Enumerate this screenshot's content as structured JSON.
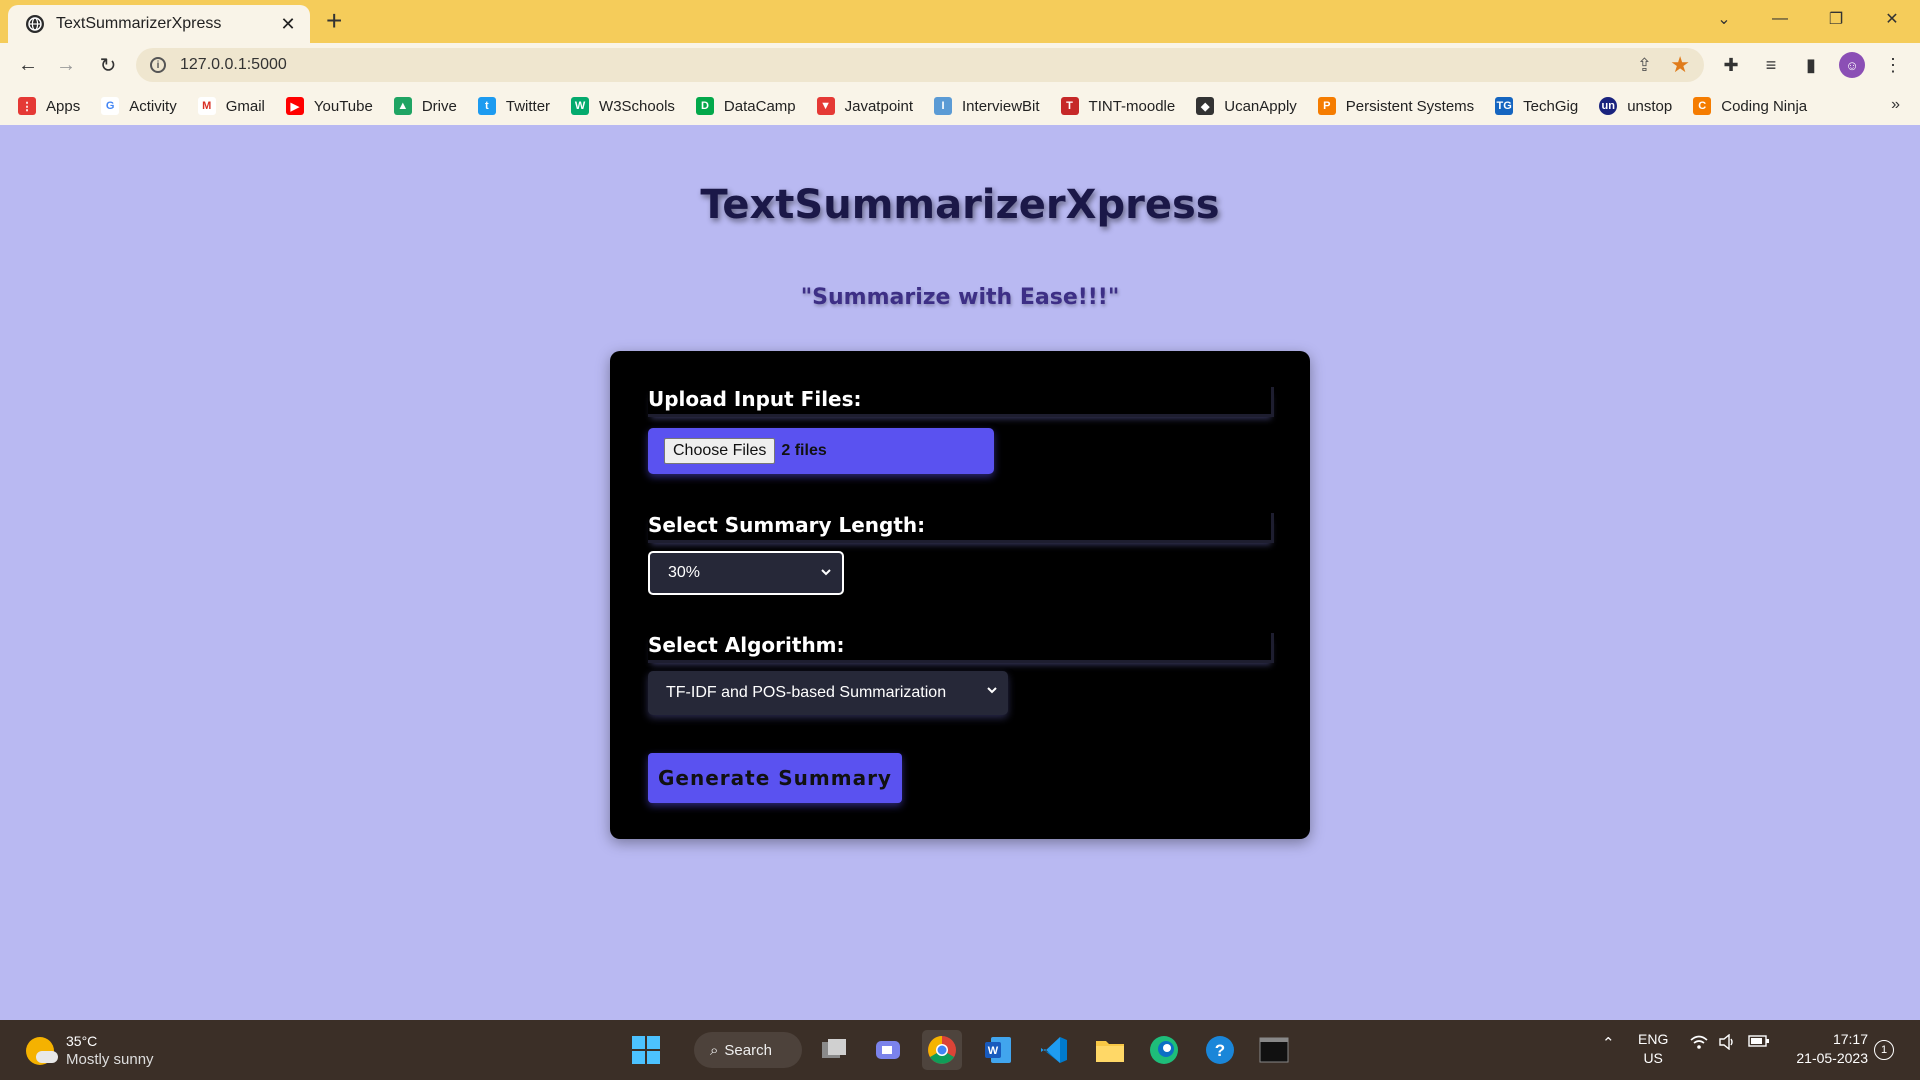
{
  "browser": {
    "tab_title": "TextSummarizerXpress",
    "url": "127.0.0.1:5000",
    "bookmarks": [
      {
        "label": "Apps",
        "color": "#e53935",
        "icon": "apps-grid-icon"
      },
      {
        "label": "Activity",
        "color": "#4285f4",
        "icon": "google-icon"
      },
      {
        "label": "Gmail",
        "color": "#d93025",
        "icon": "gmail-icon"
      },
      {
        "label": "YouTube",
        "color": "#ff0000",
        "icon": "youtube-icon"
      },
      {
        "label": "Drive",
        "color": "#1fa463",
        "icon": "drive-icon"
      },
      {
        "label": "Twitter",
        "color": "#1d9bf0",
        "icon": "twitter-icon"
      },
      {
        "label": "W3Schools",
        "color": "#04aa6d",
        "icon": "w3schools-icon"
      },
      {
        "label": "DataCamp",
        "color": "#03ef62",
        "icon": "datacamp-icon"
      },
      {
        "label": "Javatpoint",
        "color": "#e53935",
        "icon": "javatpoint-icon"
      },
      {
        "label": "InterviewBit",
        "color": "#5b9bd5",
        "icon": "interviewbit-icon"
      },
      {
        "label": "TINT-moodle",
        "color": "#c62828",
        "icon": "moodle-icon"
      },
      {
        "label": "UcanApply",
        "color": "#333333",
        "icon": "graduation-cap-icon"
      },
      {
        "label": "Persistent Systems",
        "color": "#f57c00",
        "icon": "persistent-icon"
      },
      {
        "label": "TechGig",
        "color": "#1565c0",
        "icon": "techgig-icon"
      },
      {
        "label": "unstop",
        "color": "#1a237e",
        "icon": "unstop-icon"
      },
      {
        "label": "Coding Ninja",
        "color": "#f57c00",
        "icon": "coding-ninja-icon"
      }
    ]
  },
  "page": {
    "title": "TextSummarizerXpress",
    "tagline": "\"Summarize with Ease!!!\"",
    "upload_label": "Upload Input Files:",
    "choose_button": "Choose Files",
    "file_count": "2 files",
    "length_label": "Select Summary Length:",
    "length_value": "30%",
    "algorithm_label": "Select Algorithm:",
    "algorithm_value": "TF-IDF and POS-based Summarization",
    "generate_button": "Generate Summary"
  },
  "taskbar": {
    "weather_temp": "35°C",
    "weather_desc": "Mostly sunny",
    "search_label": "Search",
    "lang_top": "ENG",
    "lang_bottom": "US",
    "time": "17:17",
    "date": "21-05-2023",
    "notification_count": "1"
  }
}
